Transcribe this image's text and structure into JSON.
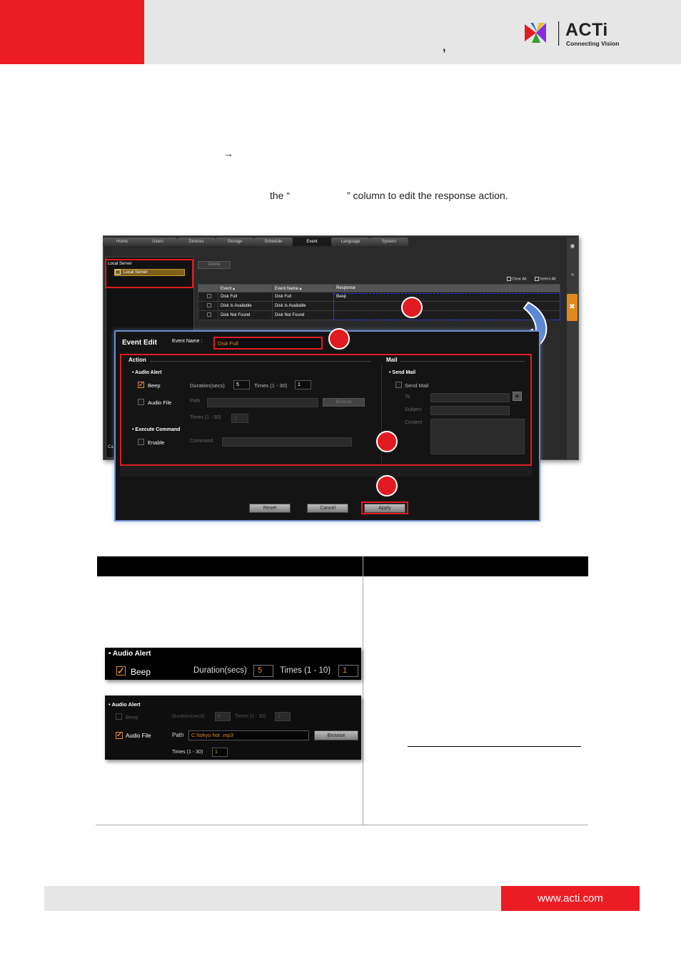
{
  "header": {
    "comma": ","
  },
  "logo": {
    "name": "ACTi",
    "tagline": "Connecting Vision"
  },
  "arrow": "→",
  "instruction": {
    "part_a": "the “",
    "part_b": "” column to edit the response action."
  },
  "app": {
    "tabs": [
      "Home",
      "Users",
      "Devices",
      "Storage",
      "Schedule",
      "Event",
      "Language",
      "System"
    ],
    "active_tab": "Event",
    "left_panel": {
      "title": "Local Server",
      "item": "Local Server",
      "cut_label": "Ca"
    },
    "delete_button": "Delete",
    "clear_all": "Clear All",
    "select_all": "Select All",
    "table": {
      "headers": [
        "",
        "Event",
        "Event Name",
        "Response"
      ],
      "rows": [
        {
          "event": "Disk Full",
          "name": "Disk Full",
          "response": "Beep"
        },
        {
          "event": "Disk Is Available",
          "name": "Disk Is Available",
          "response": ""
        },
        {
          "event": "Disk Not Found",
          "name": "Disk Not Found",
          "response": ""
        }
      ]
    }
  },
  "dialog": {
    "title": "Event Edit",
    "event_name_label": "Event Name :",
    "event_name_value": "Disk Full",
    "action_label": "Action",
    "mail_label": "Mail",
    "audio_alert": "Audio Alert",
    "beep": "Beep",
    "duration_label": "Duration(secs)",
    "duration_value": "5",
    "times_label": "Times (1 - 30)",
    "times_value": "1",
    "audio_file": "Audio File",
    "path_label": "Path",
    "browse": "Browse",
    "times2_label": "Times (1 - 30)",
    "times2_value": "1",
    "execute_command": "Execute Command",
    "enable": "Enable",
    "command_label": "Command",
    "send_mail_heading": "Send Mail",
    "send_mail": "Send Mail",
    "to_label": "To",
    "subject_label": "Subject",
    "content_label": "Content",
    "reset": "Reset",
    "cancel": "Cancel",
    "apply": "Apply"
  },
  "example1": {
    "heading": "Audio Alert",
    "beep": "Beep",
    "duration_label": "Duration(secs)",
    "duration_value": "5",
    "times_label": "Times (1 - 10)",
    "times_value": "1"
  },
  "example2": {
    "heading": "Audio Alert",
    "beep": "Beep",
    "duration_label": "Duration(secs)",
    "duration_value": "5",
    "times_label": "Times (1 - 30)",
    "times_value": "1",
    "audio_file": "Audio File",
    "path_label": "Path",
    "path_value": "C:\\tokyo hot .mp3",
    "browse": "Browse",
    "times2_label": "Times (1 - 30)",
    "times2_value": "1"
  },
  "footer": {
    "url": "www.acti.com"
  },
  "colors": {
    "brand_red": "#ec1c24",
    "header_gray": "#e6e6e6",
    "highlight_red": "#e21b22",
    "accent_orange": "#e08a30"
  }
}
